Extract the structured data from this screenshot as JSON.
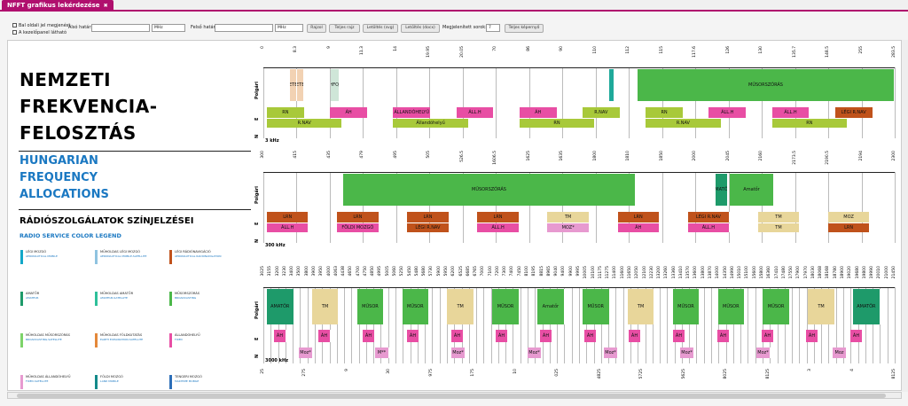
{
  "tab": {
    "title": "NFFT grafikus lekérdezése",
    "close": "✖"
  },
  "toolbar": {
    "opt1": "Bal oldali jel megjenést",
    "opt2": "A kezelőpanel látható",
    "from_label": "Alsó határ:",
    "from_unit": "MHz",
    "to_label": "Felső határ:",
    "to_unit": "MHz",
    "draw": "Rajzol",
    "full_page": "Teljes rajz",
    "download_svg": "Letöltés (svg)",
    "download_docx": "Letöltés (docx)",
    "rows_label": "Megjelenített sorok:",
    "rows_value": "7",
    "fullscreen": "Teljes képernyő"
  },
  "page": {
    "title_lines": [
      "NEMZETI",
      "FREKVENCIA-",
      "FELOSZTÁS"
    ],
    "en_lines": [
      "HUNGARIAN",
      "FREQUENCY",
      "ALLOCATIONS"
    ],
    "legend_hu": "RÁDIÓSZOLGÁLATOK SZÍNJELZÉSEI",
    "legend_en": "RADIO SERVICE COLOR LEGEND"
  },
  "legend": [
    {
      "hu": "LÉGI MOZGÓ",
      "en": "AERONAUTICAL MOBILE",
      "color": "#13a7c8"
    },
    {
      "hu": "MŰHOLDAS LÉGI MOZGÓ",
      "en": "AERONAUTICAL MOBILE-SATELLITE",
      "color": "#8fc3e0"
    },
    {
      "hu": "LÉGI RÁDIÓNAVIGÁCIÓ",
      "en": "AERONAUTICAL RADIONAVIGATION",
      "color": "#c0521b"
    },
    {
      "hu": "AMATŐR",
      "en": "AMATEUR",
      "color": "#1e9a6a"
    },
    {
      "hu": "MŰHOLDAS AMATŐR",
      "en": "AMATEUR-SATELLITE",
      "color": "#2ec09a"
    },
    {
      "hu": "MŰSORSZÓRÁS",
      "en": "BROADCASTING",
      "color": "#4bb749"
    },
    {
      "hu": "MŰHOLDAS MŰSORSZÓRÁS",
      "en": "BROADCASTING-SATELLITE",
      "color": "#7dd36a"
    },
    {
      "hu": "MŰHOLDAS FÖLDKUTATÁS",
      "en": "EARTH EXPLORATION-SATELLITE",
      "color": "#e4883a"
    },
    {
      "hu": "ÁLLANDÓHELYŰ",
      "en": "FIXED",
      "color": "#e84ea4"
    },
    {
      "hu": "MŰHOLDAS ÁLLANDÓHELYŰ",
      "en": "FIXED-SATELLITE",
      "color": "#e79ad0"
    },
    {
      "hu": "FÖLDI MOZGÓ",
      "en": "LAND MOBILE",
      "color": "#138a8a"
    },
    {
      "hu": "TENGERI MOZGÓ",
      "en": "MARITIME MOBILE",
      "color": "#2d6fb8"
    }
  ],
  "rows": {
    "primary": "Polgári",
    "e": "E",
    "n": "N"
  },
  "bands": [
    {
      "unit": "3 kHz",
      "ticks": [
        "0",
        "8.3",
        "9",
        "11.3",
        "14",
        "19.95",
        "20.05",
        "70",
        "86",
        "90",
        "110",
        "112",
        "115",
        "117.6",
        "126",
        "130",
        "135.7",
        "148.5",
        "255",
        "283.5"
      ],
      "top_blocks": [
        {
          "label": "METEO",
          "color": "#f2d2b3"
        },
        {
          "label": "METEO",
          "color": "#f2d2b3"
        },
        {
          "label": "HFOJ",
          "color": "#cfe6d8"
        },
        {
          "label": "",
          "color": "#1fa99a"
        },
        {
          "label": "MŰSORSZÓRÁS",
          "color": "#4bb749"
        }
      ],
      "mid_blocks": [
        {
          "label": "RN",
          "color": "#a8c93a"
        },
        {
          "label": "ÁH",
          "color": "#e84ea4"
        },
        {
          "label": "ÁLLANDÓHELYŰ",
          "color": "#e84ea4"
        },
        {
          "label": "ÁLL.H",
          "color": "#e84ea4"
        },
        {
          "label": "ÁH",
          "color": "#e84ea4"
        },
        {
          "label": "R.NAV",
          "color": "#a8c93a"
        },
        {
          "label": "RN",
          "color": "#a8c93a"
        },
        {
          "label": "ÁLL.H",
          "color": "#e84ea4"
        },
        {
          "label": "ÁLL.H",
          "color": "#e84ea4"
        },
        {
          "label": "LÉGI R.NAV",
          "color": "#c0521b"
        }
      ],
      "mid2_blocks": [
        {
          "label": "R.NAV",
          "color": "#a8c93a"
        },
        {
          "label": "Állandóhelyű",
          "color": "#a8c93a"
        },
        {
          "label": "RN",
          "color": "#a8c93a"
        },
        {
          "label": "R.NAV",
          "color": "#a8c93a"
        },
        {
          "label": "RN",
          "color": "#a8c93a"
        }
      ]
    },
    {
      "unit": "300 kHz",
      "ticks": [
        "300",
        "415",
        "435",
        "479",
        "495",
        "505",
        "526.5",
        "1606.5",
        "1625",
        "1635",
        "1800",
        "1810",
        "1850",
        "2000",
        "2045",
        "2160",
        "2173.5",
        "2190.5",
        "2194",
        "2300"
      ],
      "top_blocks": [
        {
          "label": "MŰSORSZÓRÁS",
          "color": "#4bb749"
        },
        {
          "label": "AMATŐR",
          "color": "#1e9a6a"
        },
        {
          "label": "Amatőr",
          "color": "#4bb749"
        }
      ],
      "mid_blocks": [
        {
          "label": "LRN",
          "color": "#c0521b"
        },
        {
          "label": "LRN",
          "color": "#c0521b"
        },
        {
          "label": "LRN",
          "color": "#c0521b"
        },
        {
          "label": "LRN",
          "color": "#c0521b"
        },
        {
          "label": "TM",
          "color": "#e8d69a"
        },
        {
          "label": "LRN",
          "color": "#c0521b"
        },
        {
          "label": "LÉGI R.NAV",
          "color": "#c0521b"
        },
        {
          "label": "TM",
          "color": "#e8d69a"
        },
        {
          "label": "MOZ",
          "color": "#e8d69a"
        }
      ],
      "mid2_blocks": [
        {
          "label": "ÁLL.H",
          "color": "#e84ea4"
        },
        {
          "label": "FÖLDI MOZGÓ",
          "color": "#e84ea4"
        },
        {
          "label": "LÉGI R.NAV",
          "color": "#c0521b"
        },
        {
          "label": "ÁLL.H",
          "color": "#e84ea4"
        },
        {
          "label": "MOZ*",
          "color": "#e79ad0"
        },
        {
          "label": "ÁH",
          "color": "#e84ea4"
        },
        {
          "label": "ÁLL.H",
          "color": "#e84ea4"
        },
        {
          "label": "TM",
          "color": "#e8d69a"
        },
        {
          "label": "LRN",
          "color": "#c0521b"
        }
      ]
    },
    {
      "unit": "3000 kHz",
      "ticks": [
        "3025",
        "3155",
        "3200",
        "3230",
        "3400",
        "3500",
        "3800",
        "3900",
        "3950",
        "4000",
        "4063",
        "4438",
        "4650",
        "4700",
        "4750",
        "4850",
        "4995",
        "5005",
        "5060",
        "5250",
        "5450",
        "5480",
        "5680",
        "5730",
        "5900",
        "5950",
        "6200",
        "6525",
        "6685",
        "6765",
        "7000",
        "7100",
        "7200",
        "7300",
        "7400",
        "7450",
        "8100",
        "8195",
        "8815",
        "8965",
        "9040",
        "9400",
        "9900",
        "9995",
        "10005",
        "10100",
        "11175",
        "11275",
        "11400",
        "11600",
        "11650",
        "12050",
        "12100",
        "12230",
        "13200",
        "13260",
        "13360",
        "13410",
        "13570",
        "13600",
        "13800",
        "13870",
        "14000",
        "14350",
        "14990",
        "15010",
        "15100",
        "15600",
        "15800",
        "16360",
        "17410",
        "17480",
        "17550",
        "17900",
        "17970",
        "18030",
        "18068",
        "18168",
        "18780",
        "18900",
        "19020",
        "19680",
        "19800",
        "19990",
        "20010",
        "21000",
        "21450"
      ],
      "blocks": [
        {
          "label": "AMATŐR",
          "color": "#1e9a6a"
        },
        {
          "label": "TM",
          "color": "#e8d69a"
        },
        {
          "label": "MŰSOR",
          "color": "#4bb749"
        },
        {
          "label": "MŰSOR",
          "color": "#4bb749"
        },
        {
          "label": "TM",
          "color": "#e8d69a"
        },
        {
          "label": "MŰSOR",
          "color": "#4bb749"
        },
        {
          "label": "Amatőr",
          "color": "#4bb749"
        },
        {
          "label": "MŰSOR",
          "color": "#4bb749"
        },
        {
          "label": "TM",
          "color": "#e8d69a"
        },
        {
          "label": "MŰSOR",
          "color": "#4bb749"
        },
        {
          "label": "MŰSOR",
          "color": "#4bb749"
        },
        {
          "label": "MŰSOR",
          "color": "#4bb749"
        },
        {
          "label": "TM",
          "color": "#e8d69a"
        },
        {
          "label": "AMATŐR",
          "color": "#1e9a6a"
        }
      ],
      "e_labels": [
        "ÁH",
        "ÁH",
        "ÁH",
        "ÁH",
        "ÁH",
        "ÁH",
        "ÁH",
        "ÁH",
        "ÁH",
        "ÁH",
        "ÁH",
        "ÁH",
        "ÁH",
        "ÁH"
      ],
      "n_labels": [
        "Moz*",
        "M**",
        "Moz*",
        "Moz*",
        "Moz*",
        "Moz*",
        "Moz*",
        "Moz"
      ]
    },
    {
      "ticks": [
        "25",
        "275",
        "9",
        "30",
        "975",
        "175",
        "10",
        "025",
        "4825",
        "5725",
        "5625",
        "8025",
        "8125",
        "3",
        "4",
        "8125"
      ]
    }
  ]
}
